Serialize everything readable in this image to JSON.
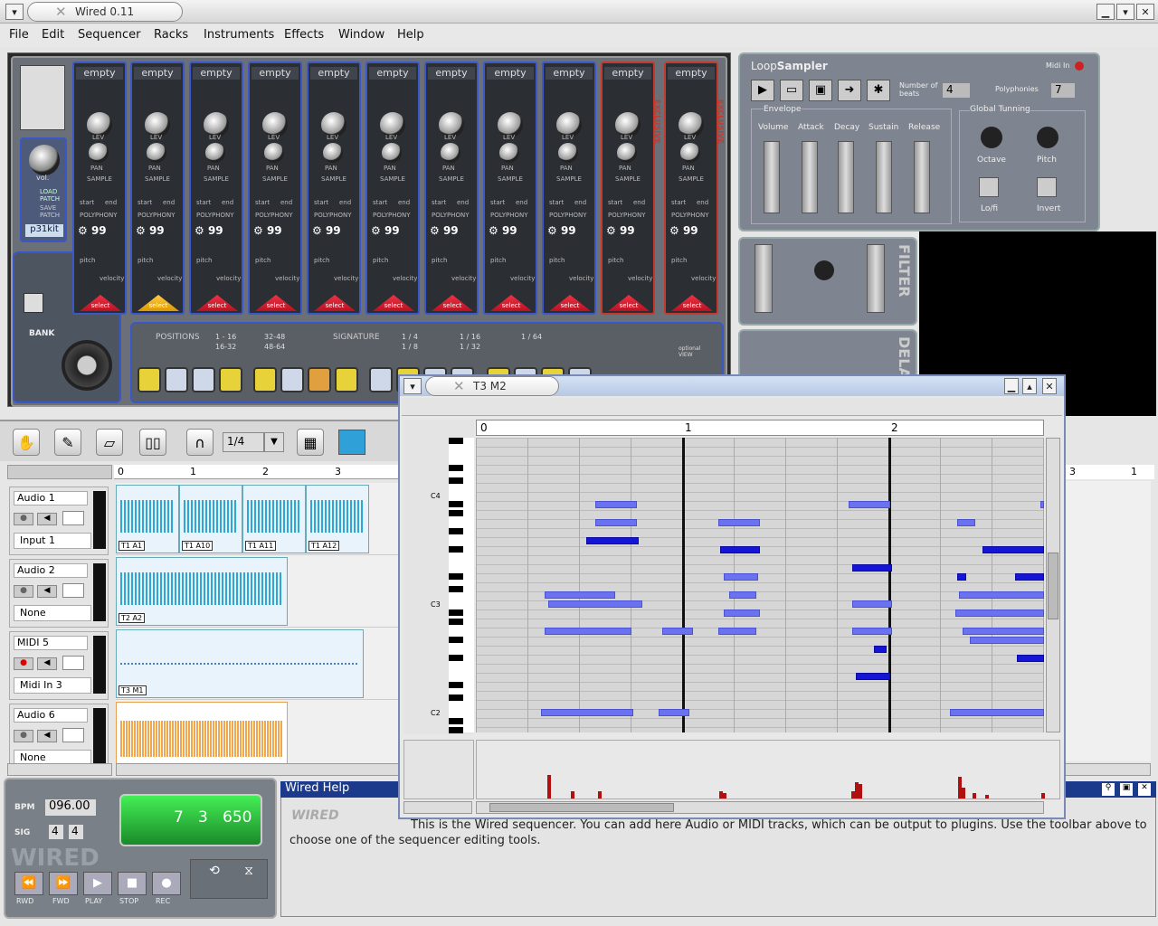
{
  "window": {
    "title": "Wired 0.11"
  },
  "menu": [
    "File",
    "Edit",
    "Sequencer",
    "Racks",
    "Instruments",
    "Effects",
    "Window",
    "Help"
  ],
  "drum": {
    "channel_label": "empty",
    "poly_value": "99",
    "select_label": "select",
    "lev": "LEV",
    "pan": "PAN",
    "sample": "SAMPLE",
    "start": "start",
    "end": "end",
    "polyphony": "POLYPHONY",
    "pitch": "pitch",
    "velocity": "velocity",
    "vol": "vol.",
    "load_patch": "LOAD PATCH",
    "save_patch": "SAVE PATCH",
    "kit": "p31kit",
    "bank": "BANK",
    "positions": "POSITIONS",
    "pos1": "1 - 16",
    "pos2": "16-32",
    "pos3": "32-48",
    "pos4": "48-64",
    "signature": "SIGNATURE",
    "sig1": "1 / 4",
    "sig2": "1 / 8",
    "sig3": "1 / 16",
    "sig4": "1 / 32",
    "sig5": "1 / 64",
    "exclusive": "EXCLUSIVE",
    "optional_view": "optional VIEW"
  },
  "sampler": {
    "title_a": "Loop",
    "title_b": "Sampler",
    "midi_in": "Midi In",
    "beats_label": "Number of beats",
    "beats": "4",
    "polyphonies_label": "Polyphonies",
    "polyphonies": "7",
    "envelope": "Envelope",
    "volume": "Volume",
    "attack": "Attack",
    "decay": "Decay",
    "sustain": "Sustain",
    "release": "Release",
    "global_tuning": "Global Tunning",
    "octave": "Octave",
    "pitch": "Pitch",
    "lofi": "Lo/fi",
    "invert": "Invert"
  },
  "filter_label": "FILTER",
  "delay_label": "DELA",
  "seq_toolbar": {
    "quantize": "1/4",
    "color": "#2fa0d8"
  },
  "ruler": [
    "0",
    "1",
    "2",
    "3"
  ],
  "tracks": [
    {
      "name": "Audio 1",
      "input": "Input 1",
      "clips": [
        "T1 A1",
        "T1 A10",
        "T1 A11",
        "T1 A12"
      ]
    },
    {
      "name": "Audio 2",
      "input": "None",
      "clips": [
        "T2 A2"
      ]
    },
    {
      "name": "MIDI 5",
      "input": "Midi In 3",
      "clips": [
        "T3 M1"
      ]
    },
    {
      "name": "Audio 6",
      "input": "None",
      "clips": []
    }
  ],
  "transport": {
    "bpm_label": "BPM",
    "bpm": "096.00",
    "sig_label": "SIG",
    "sig_num": "4",
    "sig_den": "4",
    "position": "7   3   650",
    "logo": "WIRED",
    "buttons": [
      "RWD",
      "FWD",
      "PLAY",
      "STOP",
      "REC"
    ]
  },
  "help": {
    "title": "Wired Help",
    "logo": "WIRED",
    "text": "This is the Wired sequencer. You can add here Audio or MIDI tracks, which can be output to plugins. Use the toolbar above to choose one of the sequencer editing tools."
  },
  "editor": {
    "title": "T3 M2",
    "ruler": [
      "0",
      "1",
      "2"
    ],
    "key_labels": [
      "C4",
      "C3",
      "C2"
    ],
    "right_ruler": [
      "3",
      "1"
    ]
  }
}
